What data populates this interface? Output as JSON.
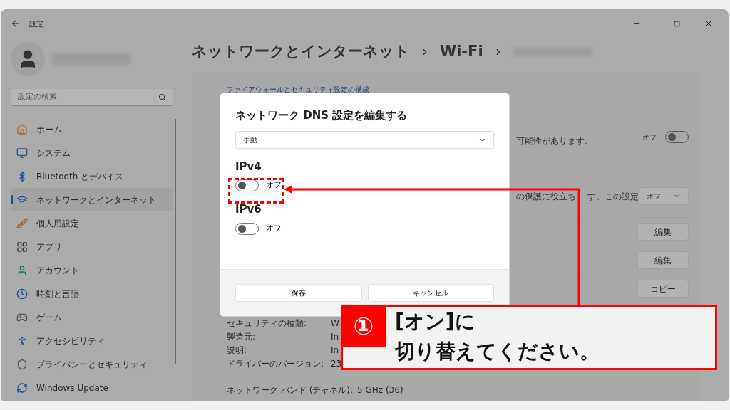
{
  "window": {
    "title": "設定"
  },
  "sidebar": {
    "search_placeholder": "設定の検索",
    "items": [
      {
        "label": "ホーム",
        "selected": false
      },
      {
        "label": "システム",
        "selected": false
      },
      {
        "label": "Bluetooth とデバイス",
        "selected": false
      },
      {
        "label": "ネットワークとインターネット",
        "selected": true
      },
      {
        "label": "個人用設定",
        "selected": false
      },
      {
        "label": "アプリ",
        "selected": false
      },
      {
        "label": "アカウント",
        "selected": false
      },
      {
        "label": "時刻と言語",
        "selected": false
      },
      {
        "label": "ゲーム",
        "selected": false
      },
      {
        "label": "アクセシビリティ",
        "selected": false
      },
      {
        "label": "プライバシーとセキュリティ",
        "selected": false
      },
      {
        "label": "Windows Update",
        "selected": false
      }
    ]
  },
  "breadcrumb": [
    "ネットワークとインターネット",
    "Wi-Fi"
  ],
  "content": {
    "link": "ファイアウォールとセキュリティ設定の構成",
    "rows": [
      {
        "kind": "toggle",
        "text": "可能性があります。",
        "state_label": "オフ",
        "on": false
      },
      {
        "kind": "dropdown",
        "text": "の保護に役立ち",
        "text_after": "す。この設定",
        "value": "オフ"
      },
      {
        "kind": "button",
        "button": "編集"
      },
      {
        "kind": "button",
        "button": "編集"
      },
      {
        "kind": "button",
        "button": "コピー"
      }
    ],
    "properties": [
      {
        "label": "セキュリティの種類:",
        "value": "W"
      },
      {
        "label": "製造元:",
        "value": "In"
      },
      {
        "label": "説明:",
        "value": "In"
      },
      {
        "label": "ドライバーのバージョン:",
        "value": "23"
      },
      {
        "label": "ネットワーク バンド (チャネル):",
        "value": "5 GHz (36)"
      }
    ]
  },
  "dialog": {
    "title": "ネットワーク DNS 設定を編集する",
    "mode": "手動",
    "toggles": [
      {
        "label": "IPv4",
        "state_label": "オフ",
        "on": false
      },
      {
        "label": "IPv6",
        "state_label": "オフ",
        "on": false
      }
    ],
    "buttons": [
      "保存",
      "キャンセル"
    ]
  },
  "annotation": {
    "step": "①",
    "lines": [
      "[オン]に",
      "切り替えてください。"
    ]
  }
}
